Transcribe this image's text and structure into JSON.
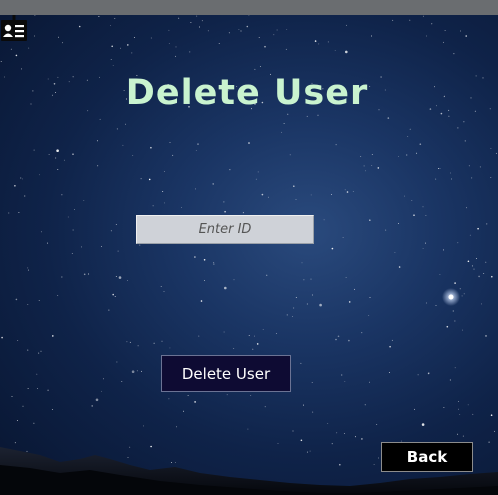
{
  "page": {
    "title": "Delete User"
  },
  "form": {
    "id_input": {
      "value": "",
      "placeholder": "Enter ID"
    },
    "id_icon": "id-card-icon",
    "delete_label": "Delete User"
  },
  "navigation": {
    "back_label": "Back"
  },
  "colors": {
    "title": "#c9f3cf",
    "delete_button_bg": "#0e0b33",
    "back_button_bg": "#000000"
  }
}
